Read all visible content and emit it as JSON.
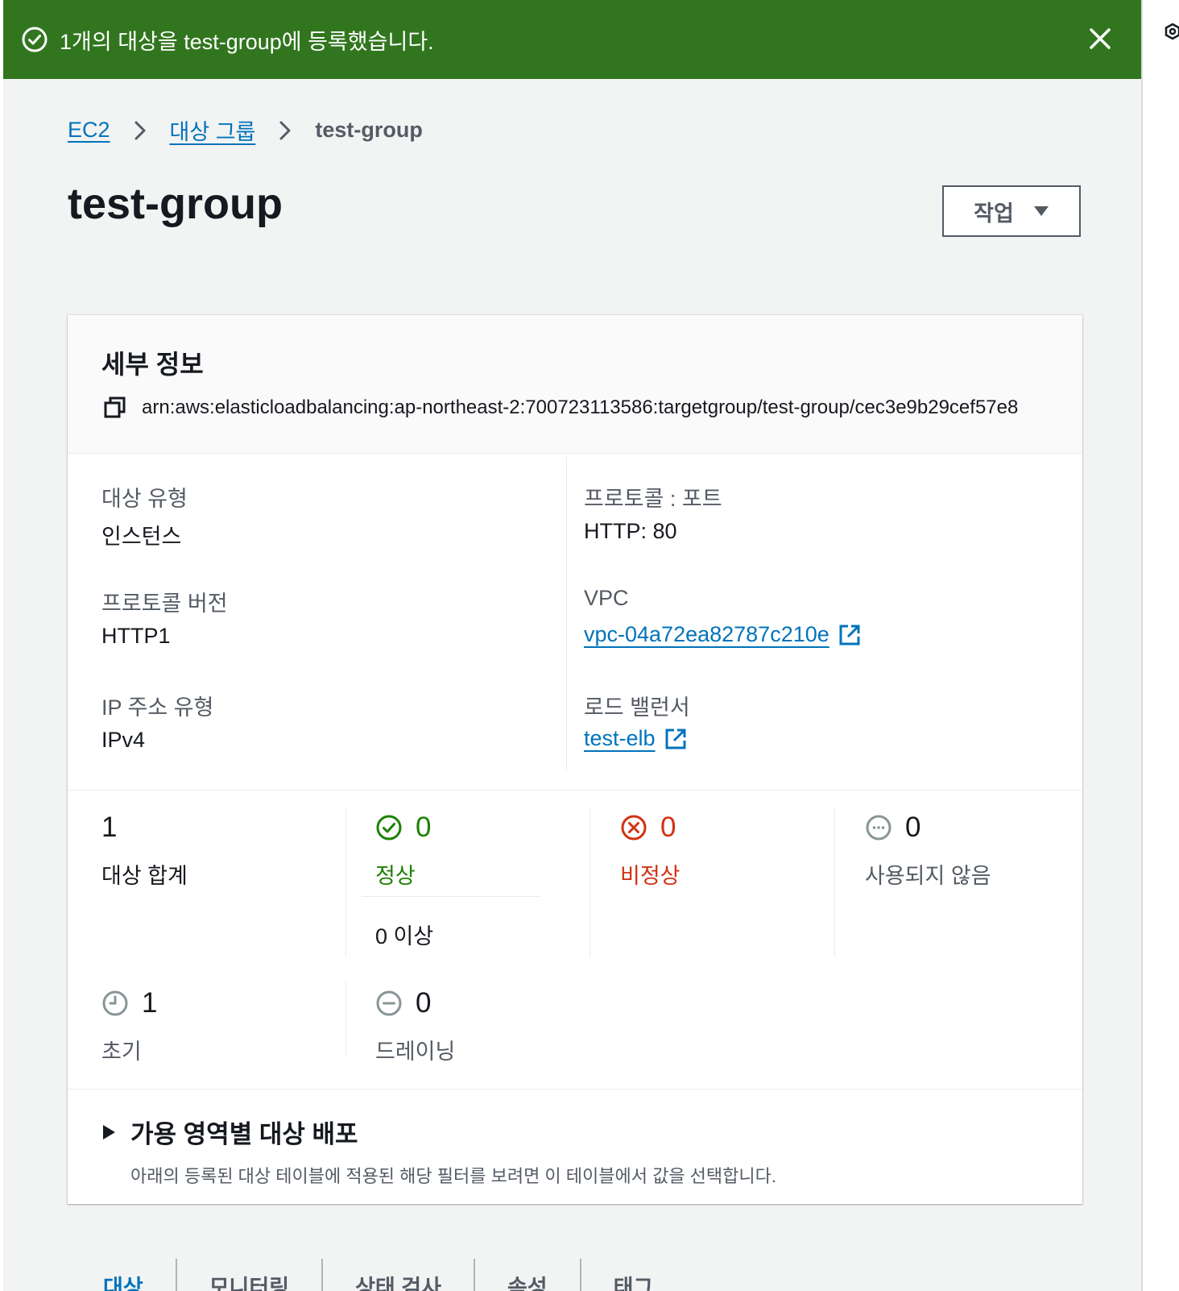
{
  "flash": {
    "message": "1개의 대상을 test-group에 등록했습니다.",
    "background": "#31761f"
  },
  "breadcrumb": {
    "items": [
      "EC2",
      "대상 그룹"
    ],
    "current": "test-group"
  },
  "page": {
    "title": "test-group",
    "actions_label": "작업"
  },
  "details": {
    "title": "세부 정보",
    "arn": "arn:aws:elasticloadbalancing:ap-northeast-2:700723113586:targetgroup/test-group/cec3e9b29cef57e8",
    "target_type": {
      "label": "대상 유형",
      "value": "인스턴스"
    },
    "protocol_version": {
      "label": "프로토콜 버전",
      "value": "HTTP1"
    },
    "ip_address_type": {
      "label": "IP 주소 유형",
      "value": "IPv4"
    },
    "protocol_port": {
      "label": "프로토콜 : 포트",
      "value": "HTTP: 80"
    },
    "vpc": {
      "label": "VPC",
      "value": "vpc-04a72ea82787c210e"
    },
    "load_balancer": {
      "label": "로드 밸런서",
      "value": "test-elb"
    }
  },
  "stats": {
    "total": {
      "value": "1",
      "label": "대상 합계"
    },
    "healthy": {
      "value": "0",
      "label": "정상",
      "threshold": "0 이상",
      "color": "#1d8102"
    },
    "unhealthy": {
      "value": "0",
      "label": "비정상",
      "color": "#d13212"
    },
    "unused": {
      "value": "0",
      "label": "사용되지 않음"
    },
    "initial": {
      "value": "1",
      "label": "초기"
    },
    "draining": {
      "value": "0",
      "label": "드레이닝"
    }
  },
  "distribution": {
    "title": "가용 영역별 대상 배포",
    "description": "아래의 등록된 대상 테이블에 적용된 해당 필터를 보려면 이 테이블에서 값을 선택합니다."
  },
  "tabs": [
    "대상",
    "모니터링",
    "상태 검사",
    "속성",
    "태그"
  ]
}
